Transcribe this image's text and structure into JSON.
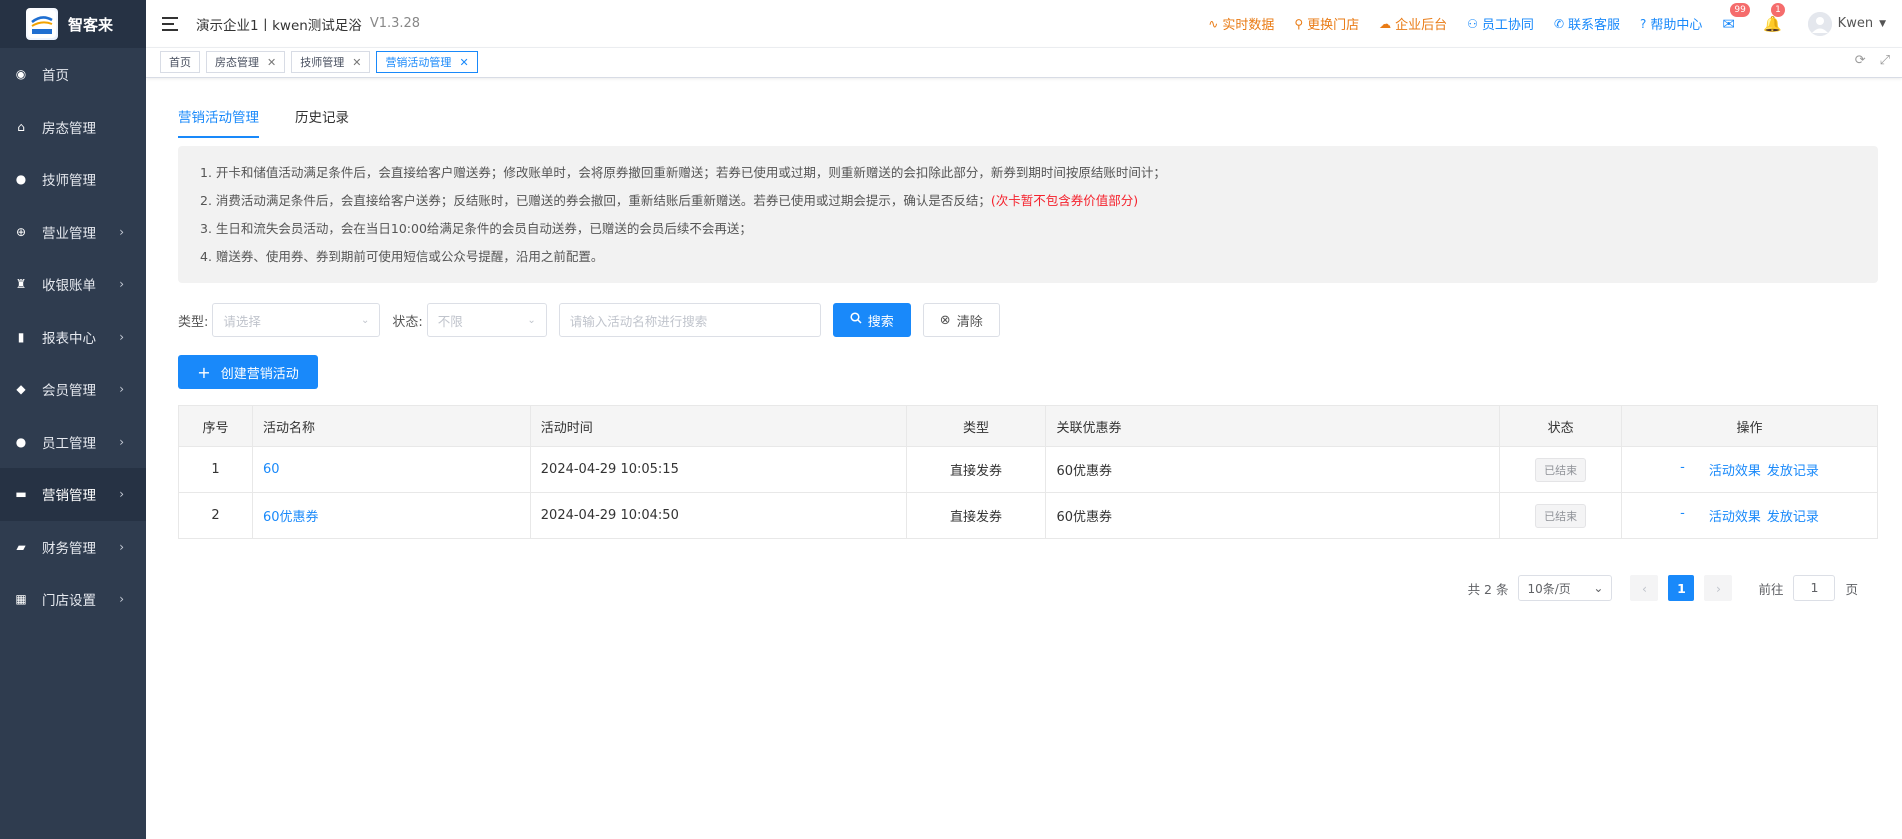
{
  "brand": {
    "logo_text": "智客来",
    "name": "智客来"
  },
  "sidebar": {
    "items": [
      {
        "label": "首页",
        "icon": "dashboard-icon",
        "arrow": false
      },
      {
        "label": "房态管理",
        "icon": "home-icon",
        "arrow": false
      },
      {
        "label": "技师管理",
        "icon": "user-icon",
        "arrow": false
      },
      {
        "label": "营业管理",
        "icon": "plus-circle-icon",
        "arrow": true
      },
      {
        "label": "收银账单",
        "icon": "money-bag-icon",
        "arrow": true
      },
      {
        "label": "报表中心",
        "icon": "bar-chart-icon",
        "arrow": true
      },
      {
        "label": "会员管理",
        "icon": "diamond-icon",
        "arrow": true
      },
      {
        "label": "员工管理",
        "icon": "user-icon",
        "arrow": true
      },
      {
        "label": "营销管理",
        "icon": "briefcase-icon",
        "arrow": true,
        "active": true
      },
      {
        "label": "财务管理",
        "icon": "wallet-icon",
        "arrow": true
      },
      {
        "label": "门店设置",
        "icon": "grid-icon",
        "arrow": true
      }
    ]
  },
  "header": {
    "company": "演示企业1丨kwen测试足浴",
    "version": "V1.3.28",
    "links": [
      {
        "label": "实时数据",
        "icon": "trend-icon",
        "color": "orange"
      },
      {
        "label": "更换门店",
        "icon": "search-icon",
        "color": "orange"
      },
      {
        "label": "企业后台",
        "icon": "cloud-icon",
        "color": "orange"
      },
      {
        "label": "员工协同",
        "icon": "users-icon",
        "color": "blue"
      },
      {
        "label": "联系客服",
        "icon": "phone-icon",
        "color": "blue"
      },
      {
        "label": "帮助中心",
        "icon": "help-icon",
        "color": "blue"
      }
    ],
    "mail_badge": "99",
    "bell_badge": "1",
    "user_name": "Kwen"
  },
  "view_tabs": [
    {
      "label": "首页",
      "closable": false
    },
    {
      "label": "房态管理",
      "closable": true
    },
    {
      "label": "技师管理",
      "closable": true
    },
    {
      "label": "营销活动管理",
      "closable": true,
      "active": true
    }
  ],
  "subtabs": [
    {
      "label": "营销活动管理",
      "active": true
    },
    {
      "label": "历史记录",
      "active": false
    }
  ],
  "notice": {
    "line1": "1. 开卡和储值活动满足条件后，会直接给客户赠送券；修改账单时，会将原券撤回重新赠送；若券已使用或过期，则重新赠送的会扣除此部分，新券到期时间按原结账时间计；",
    "line2": "2. 消费活动满足条件后，会直接给客户送券；反结账时，已赠送的券会撤回，重新结账后重新赠送。若券已使用或过期会提示，确认是否反结；",
    "line2_red": "(次卡暂不包含券价值部分)",
    "line3": "3. 生日和流失会员活动，会在当日10:00给满足条件的会员自动送券，已赠送的会员后续不会再送；",
    "line4": "4. 赠送券、使用券、券到期前可使用短信或公众号提醒，沿用之前配置。"
  },
  "filters": {
    "type_label": "类型:",
    "type_placeholder": "请选择",
    "status_label": "状态:",
    "status_value": "不限",
    "search_placeholder": "请输入活动名称进行搜索",
    "search_button": "搜索",
    "clear_button": "清除"
  },
  "create_button": "创建营销活动",
  "table": {
    "headers": [
      "序号",
      "活动名称",
      "活动时间",
      "类型",
      "关联优惠券",
      "状态",
      "操作"
    ],
    "rows": [
      {
        "index": "1",
        "name": "60",
        "time": "2024-04-29 10:05:15",
        "type": "直接发券",
        "coupon": "60优惠券",
        "status": "已结束",
        "op_dash": "-",
        "op_effect": "活动效果",
        "op_record": "发放记录"
      },
      {
        "index": "2",
        "name": "60优惠券",
        "time": "2024-04-29 10:04:50",
        "type": "直接发券",
        "coupon": "60优惠券",
        "status": "已结束",
        "op_dash": "-",
        "op_effect": "活动效果",
        "op_record": "发放记录"
      }
    ]
  },
  "pagination": {
    "total": "共 2 条",
    "page_size": "10条/页",
    "current": "1",
    "goto_prefix": "前往",
    "goto_value": "1",
    "goto_suffix": "页"
  },
  "colors": {
    "primary": "#1989fa",
    "sidebar": "#2f3c4f",
    "orange": "#e97b15",
    "danger": "#f5222d"
  }
}
